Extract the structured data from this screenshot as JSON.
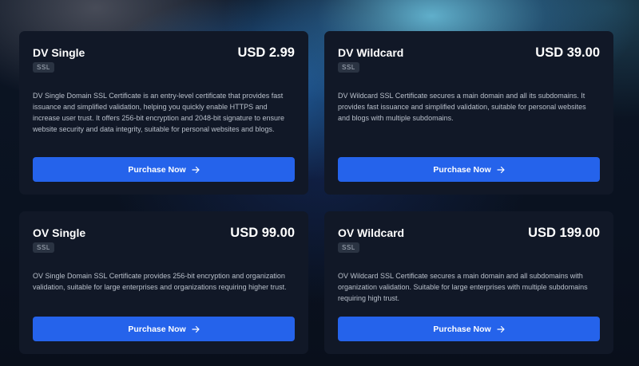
{
  "products": [
    {
      "title": "DV Single",
      "price": "USD 2.99",
      "badge": "SSL",
      "description": "DV Single Domain SSL Certificate is an entry-level certificate that provides fast issuance and simplified validation, helping you quickly enable HTTPS and increase user trust. It offers 256-bit encryption and 2048-bit signature to ensure website security and data integrity, suitable for personal websites and blogs.",
      "button_label": "Purchase Now"
    },
    {
      "title": "DV Wildcard",
      "price": "USD 39.00",
      "badge": "SSL",
      "description": "DV Wildcard SSL Certificate secures a main domain and all its subdomains. It provides fast issuance and simplified validation, suitable for personal websites and blogs with multiple subdomains.",
      "button_label": "Purchase Now"
    },
    {
      "title": "OV Single",
      "price": "USD 99.00",
      "badge": "SSL",
      "description": "OV Single Domain SSL Certificate provides 256-bit encryption and organization validation, suitable for large enterprises and organizations requiring higher trust.",
      "button_label": "Purchase Now"
    },
    {
      "title": "OV Wildcard",
      "price": "USD 199.00",
      "badge": "SSL",
      "description": "OV Wildcard SSL Certificate secures a main domain and all subdomains with organization validation. Suitable for large enterprises with multiple subdomains requiring high trust.",
      "button_label": "Purchase Now"
    }
  ],
  "icons": {
    "button_icon": "arrow-right-icon"
  },
  "colors": {
    "card_bg": "#111827",
    "button": "#2563eb",
    "badge_bg": "#2a3342"
  }
}
